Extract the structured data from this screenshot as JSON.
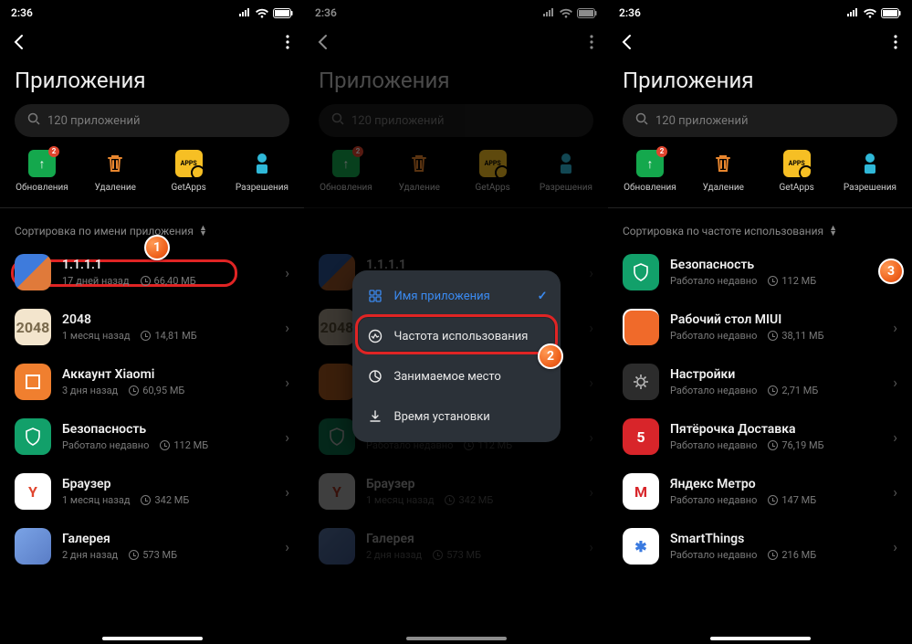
{
  "status": {
    "time": "2:36"
  },
  "header": {
    "title": "Приложения"
  },
  "search": {
    "placeholder": "120 приложений"
  },
  "actions": {
    "updates": {
      "label": "Обновления",
      "badge": "2"
    },
    "delete": {
      "label": "Удаление"
    },
    "getapps": {
      "label": "GetApps"
    },
    "permissions": {
      "label": "Разрешения"
    }
  },
  "sort": {
    "byName": "Сортировка по имени приложения",
    "byUsage": "Сортировка по частоте использования"
  },
  "popup": {
    "byName": "Имя приложения",
    "byUsage": "Частота использования",
    "bySize": "Занимаемое место",
    "byDate": "Время установки"
  },
  "apps": {
    "a1111": {
      "name": "1.1.1.1",
      "time": "17 дней назад",
      "size": "66,40 МБ"
    },
    "a2048": {
      "name": "2048",
      "time": "1 месяц назад",
      "size": "14,81 МБ"
    },
    "xiaomi": {
      "name": "Аккаунт Xiaomi",
      "time": "3 дня назад",
      "size": "60,95 МБ"
    },
    "sec": {
      "name": "Безопасность",
      "time": "Работало недавно",
      "size": "112 МБ"
    },
    "browser": {
      "name": "Браузер",
      "time": "1 месяц назад",
      "size": "342 МБ"
    },
    "gallery": {
      "name": "Галерея",
      "time": "2 дня назад",
      "size": "573 МБ"
    },
    "miui": {
      "name": "Рабочий стол MIUI",
      "time": "Работало недавно",
      "size": "38,11 МБ"
    },
    "settings": {
      "name": "Настройки",
      "time": "Работало недавно",
      "size": "2,71 МБ"
    },
    "pyat": {
      "name": "Пятёрочка Доставка",
      "time": "Работало недавно",
      "size": "76,19 МБ"
    },
    "metro": {
      "name": "Яндекс Метро",
      "time": "Работало недавно",
      "size": "147 МБ"
    },
    "smart": {
      "name": "SmartThings",
      "time": "Работало недавно",
      "size": "216 МБ"
    }
  },
  "badges": {
    "n1": "1",
    "n2": "2",
    "n3": "3"
  }
}
